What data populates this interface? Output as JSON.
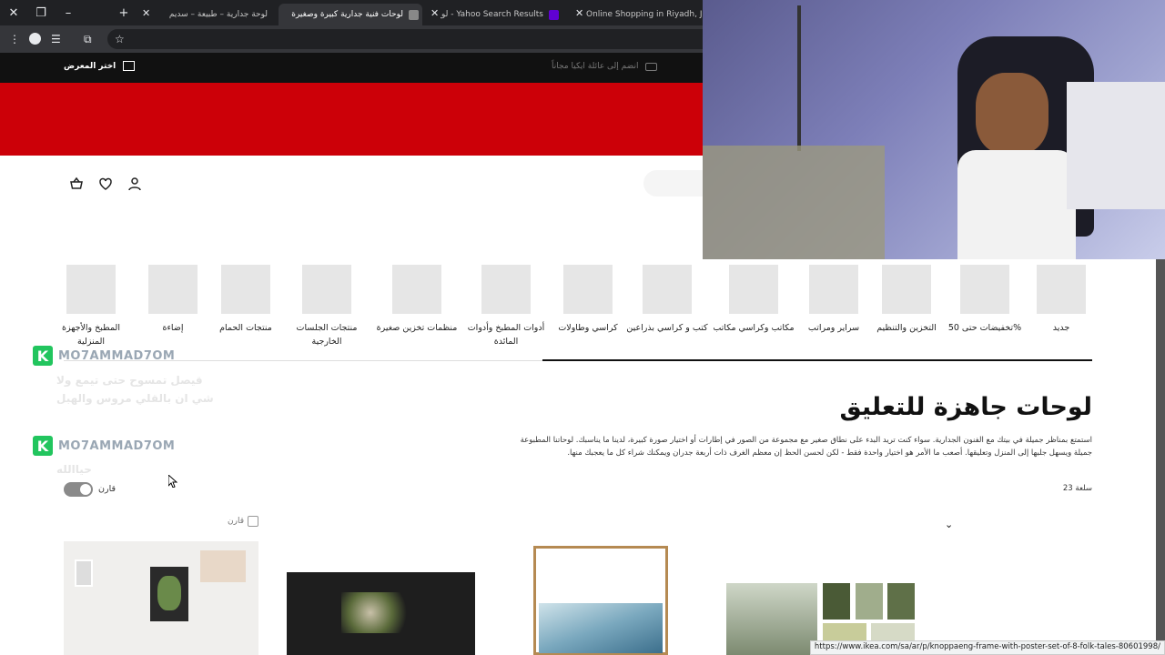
{
  "browser": {
    "tabs": [
      {
        "title": "لوحة جدارية – طبيعة – سديم",
        "active": false,
        "favicon_color": "#777777"
      },
      {
        "title": "لوحات فنية جدارية كبيرة وصغيرة",
        "active": true,
        "favicon_color": "#888888"
      },
      {
        "title": "لوح جداريه - Yahoo Search Results",
        "active": false,
        "favicon_color": "#6001d2"
      },
      {
        "title": "Online Shopping in Riyadh, Jed",
        "active": false,
        "favicon_color": "#ffcc00"
      }
    ],
    "status_url": "https://www.ikea.com/sa/ar/p/knoppaeng-frame-with-poster-set-of-8-folk-tales-80601998/"
  },
  "site": {
    "store_link": "اختر المعرض",
    "family_link": "انضم إلى عائلة ايكيا مجاناً",
    "categories": [
      "جديد",
      "تخفيضات حتى 50%",
      "التخزين والتنظيم",
      "سراير ومراتب",
      "مكاتب وكراسي مكاتب",
      "كتب و كراسي بذراعين",
      "كراسي وطاولات",
      "أدوات المطبخ وأدوات المائدة",
      "منظمات تخزين صغيرة",
      "منتجات الجلسات الخارجية",
      "منتجات الحمام",
      "إضاءة",
      "المطبخ والأجهزة المنزلية"
    ],
    "page_title": "لوحات جاهزة للتعليق",
    "intro": "استمتع بمناظر جميلة في بيتك مع الفنون الجدارية. سواء كنت تريد البدء على نطاق صغير مع مجموعة من الصور في إطارات أو اختيار صورة كبيرة، لدينا ما يناسبك. لوحاتنا المطبوعة جميلة ويسهل جلبها إلى المنزل وتعليقها. أصعب ما الأمر هو اختيار واحدة فقط - لكن لحسن الحظ إن معظم الغرف ذات أربعة جدران ويمكنك شراء كل ما يعجبك منها.",
    "item_count": "23 سلعة",
    "compare_label": "قارن",
    "compare_checkbox_label": "قارن"
  },
  "overlay": {
    "watermark_name": "MO7AMMAD7OM",
    "ghost_text_1": "قيصل تمسوح حتى تيمع ولا شي ان بالقلي مروس والهبل",
    "ghost_text_2": "حياالله"
  }
}
